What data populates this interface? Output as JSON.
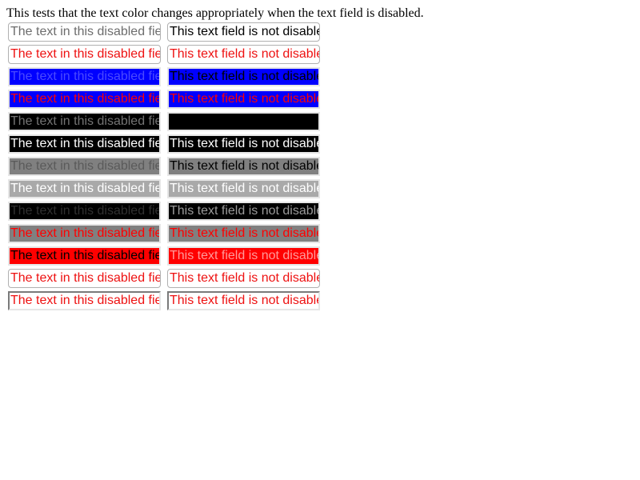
{
  "heading": "This tests that the text color changes appropriately when the text field is disabled.",
  "disabled_text": "The text in this disabled field should displayed as dimmed or grey",
  "enabled_text": "This text field is not disabled",
  "rows": [
    {
      "style": "round",
      "a_bg": "#ffffff",
      "a_fg": "#6d6d6d",
      "b_bg": "#ffffff",
      "b_fg": "#000000"
    },
    {
      "style": "round",
      "a_bg": "#ffffff",
      "a_fg": "#ee1111",
      "b_bg": "#ffffff",
      "b_fg": "#ee1111"
    },
    {
      "style": "solid",
      "a_bg": "#0000ff",
      "a_fg": "#4a4aff",
      "b_bg": "#0000ff",
      "b_fg": "#000000"
    },
    {
      "style": "solid",
      "a_bg": "#0000ff",
      "a_fg": "#ff0000",
      "b_bg": "#0000ff",
      "b_fg": "#ff0000"
    },
    {
      "style": "solid",
      "a_bg": "#000000",
      "a_fg": "#737373",
      "b_bg": "#000000",
      "b_fg": "#000000"
    },
    {
      "style": "solid",
      "a_bg": "#000000",
      "a_fg": "#ffffff",
      "b_bg": "#000000",
      "b_fg": "#ffffff"
    },
    {
      "style": "solid",
      "a_bg": "#808080",
      "a_fg": "#5a5a5a",
      "b_bg": "#808080",
      "b_fg": "#000000"
    },
    {
      "style": "solid",
      "a_bg": "#a9a9a9",
      "a_fg": "#ffffff",
      "b_bg": "#a9a9a9",
      "b_fg": "#ffffff"
    },
    {
      "style": "solid",
      "a_bg": "#000000",
      "a_fg": "#303030",
      "b_bg": "#000000",
      "b_fg": "#9a9a9a"
    },
    {
      "style": "solid",
      "a_bg": "#808080",
      "a_fg": "#ff0000",
      "b_bg": "#808080",
      "b_fg": "#ff0000"
    },
    {
      "style": "solid",
      "a_bg": "#ff0000",
      "a_fg": "#000000",
      "b_bg": "#ff0000",
      "b_fg": "#ff9a9a"
    },
    {
      "style": "round",
      "a_bg": "#ffffff",
      "a_fg": "#ee1111",
      "b_bg": "#ffffff",
      "b_fg": "#ee1111"
    },
    {
      "style": "inset",
      "a_bg": "#ffffff",
      "a_fg": "#ee1111",
      "b_bg": "#ffffff",
      "b_fg": "#ee1111"
    }
  ]
}
